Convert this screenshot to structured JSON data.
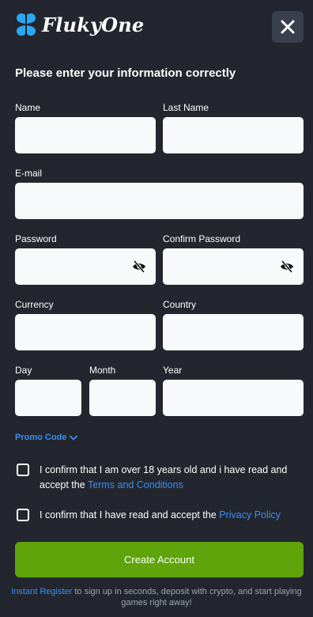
{
  "header": {
    "brand_name": "FlukyOne",
    "close_label": "×"
  },
  "form": {
    "title": "Please enter your information correctly",
    "fields": {
      "name": {
        "label": "Name",
        "value": "",
        "placeholder": ""
      },
      "last_name": {
        "label": "Last Name",
        "value": "",
        "placeholder": ""
      },
      "email": {
        "label": "E-mail",
        "value": "",
        "placeholder": ""
      },
      "password": {
        "label": "Password",
        "value": "",
        "placeholder": ""
      },
      "confirm_password": {
        "label": "Confirm Password",
        "value": "",
        "placeholder": ""
      },
      "currency": {
        "label": "Currency",
        "value": "",
        "placeholder": ""
      },
      "country": {
        "label": "Country",
        "value": "",
        "placeholder": ""
      },
      "day": {
        "label": "Day",
        "value": "",
        "placeholder": ""
      },
      "month": {
        "label": "Month",
        "value": "",
        "placeholder": ""
      },
      "year": {
        "label": "Year",
        "value": "",
        "placeholder": ""
      }
    },
    "promo_code_label": "Promo Code",
    "consent_age": {
      "text": "I confirm that I am over 18 years old and i have read and accept the ",
      "link": "Terms and Conditions",
      "checked": false
    },
    "consent_privacy": {
      "text": "I confirm that I have read and accept the ",
      "link": "Privacy Policy",
      "checked": false
    },
    "submit_label": "Create Account"
  },
  "footer": {
    "link": "Instant Register",
    "text": " to sign up in seconds, deposit with crypto, and start playing games right away!"
  },
  "colors": {
    "background": "#23262f",
    "accent_green": "#5ea40a",
    "link_blue": "#3a8ff0",
    "logo_blue": "#2aa8f2"
  },
  "icons": {
    "logo": "clover-logo-icon",
    "close": "close-icon",
    "password_toggle": "eye-slash-icon",
    "promo": "chevron-down-icon"
  }
}
